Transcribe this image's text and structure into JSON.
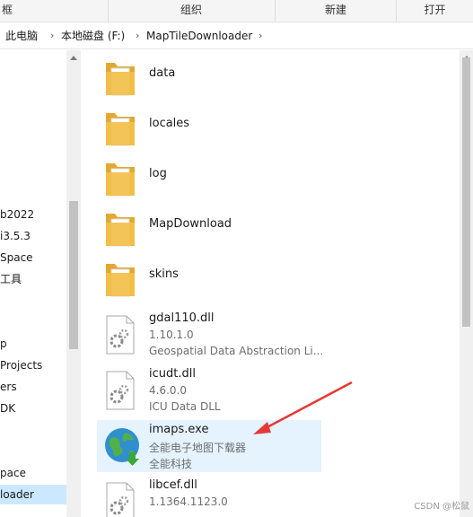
{
  "ribbon": {
    "groups": [
      "框",
      "组织",
      "新建",
      "打开"
    ]
  },
  "address": {
    "crumbs": [
      "此电脑",
      "本地磁盘 (F:)",
      "MapTileDownloader"
    ]
  },
  "nav": {
    "items": [
      "b2022",
      "i3.5.3",
      "Space",
      "工具",
      "p",
      "Projects",
      "ers",
      "DK",
      "pace",
      "loader"
    ]
  },
  "files": [
    {
      "name": "data",
      "type": "folder"
    },
    {
      "name": "locales",
      "type": "folder"
    },
    {
      "name": "log",
      "type": "folder"
    },
    {
      "name": "MapDownload",
      "type": "folder"
    },
    {
      "name": "skins",
      "type": "folder"
    },
    {
      "name": "gdal110.dll",
      "version": "1.10.1.0",
      "description": "Geospatial Data Abstraction Li..."
    },
    {
      "name": "icudt.dll",
      "version": "4.6.0.0",
      "description": "ICU Data DLL"
    },
    {
      "name": "imaps.exe",
      "version": "全能电子地图下载器",
      "description": "全能科技"
    },
    {
      "name": "libcef.dll",
      "version": "1.1364.1123.0",
      "description": ""
    }
  ],
  "watermark": "CSDN @松鼠",
  "colors": {
    "folder": "#f2c04a",
    "selection": "#e5f3ff",
    "arrow": "#e53935"
  }
}
